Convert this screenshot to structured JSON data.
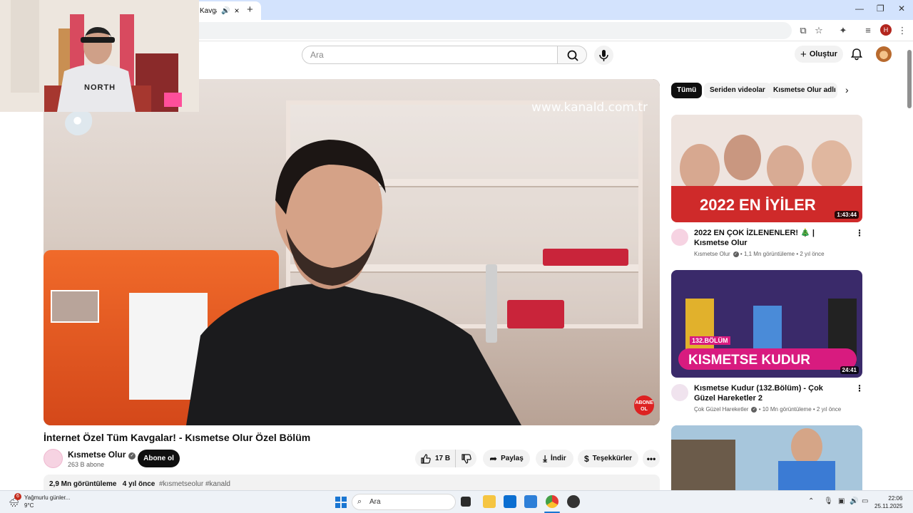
{
  "browser": {
    "tab_title": "Kavgalar",
    "new_tab": "+",
    "close_tab": "×",
    "profile_initial": "H"
  },
  "header": {
    "search_placeholder": "Ara",
    "create_label": "Oluştur"
  },
  "player": {
    "watermark": "www.kanald.com.tr",
    "badge_text": "ABONE OL"
  },
  "video": {
    "title": "İnternet Özel Tüm Kavgalar! - Kısmetse Olur Özel Bölüm",
    "channel": "Kısmetse Olur",
    "subscribers": "263 B abone",
    "subscribe_label": "Abone ol",
    "likes": "17 B",
    "share_label": "Paylaş",
    "download_label": "İndir",
    "thanks_label": "Teşekkürler",
    "views": "2,9 Mn görüntüleme",
    "age": "4 yıl önce",
    "tags": "#kısmetseolur #kanald"
  },
  "chips": [
    "Tümü",
    "Seriden videolar",
    "Kısmetse Olur adlı yü"
  ],
  "recommendations": [
    {
      "title": "2022 EN ÇOK İZLENENLER! 🎄 | Kısmetse Olur",
      "channel": "Kısmetse Olur",
      "views": "1,1 Mn görüntüleme",
      "age": "2 yıl önce",
      "duration": "1:43:44",
      "thumb_text": "2022 EN İYİLER"
    },
    {
      "title": "Kısmetse Kudur (132.Bölüm) - Çok Güzel Hareketler 2",
      "channel": "Çok Güzel Hareketler",
      "views": "10 Mn görüntüleme",
      "age": "2 yıl önce",
      "duration": "24:41",
      "thumb_text": "KISMETSE KUDUR",
      "thumb_badge": "132.BÖLÜM"
    }
  ],
  "taskbar": {
    "weather_text": "Yağmurlu günler...",
    "temperature": "9°C",
    "weather_badge": "6",
    "search_label": "Ara",
    "time": "22:06",
    "date": "25.11.2025"
  },
  "webcam": {
    "shirt_text": "NORTH"
  }
}
